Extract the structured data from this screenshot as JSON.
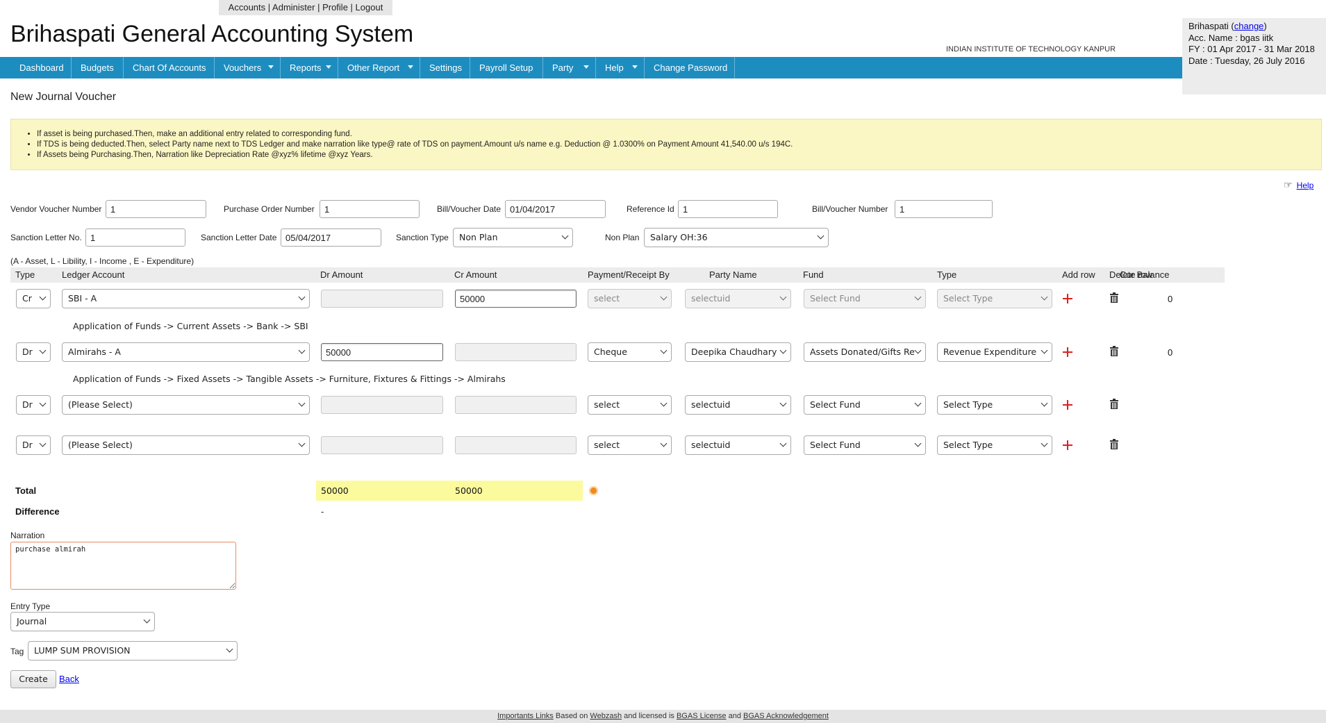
{
  "top_links": [
    "Accounts",
    "Administer",
    "Profile",
    "Logout"
  ],
  "app_title": "Brihaspati General Accounting System",
  "institute": "INDIAN INSTITUTE OF TECHNOLOGY KANPUR",
  "account_box": {
    "user": "Brihaspati",
    "change_link": "change",
    "account_name": "Acc. Name : bgas iitk",
    "fy": "FY : 01 Apr 2017 - 31 Mar 2018",
    "date": "Date : Tuesday, 26 July 2016"
  },
  "nav": [
    "Dashboard",
    "Budgets",
    "Chart Of Accounts",
    "Vouchers",
    "Reports",
    "Other Report",
    "Settings",
    "Payroll Setup",
    "Party",
    "Help",
    "Change Password"
  ],
  "page_title": "New Journal Voucher",
  "notices": [
    "If asset is being purchased.Then, make an additional entry related to corresponding fund.",
    "If TDS is being deducted.Then, select Party name next to TDS Ledger and make narration like type@ rate of TDS on payment.Amount u/s name e.g. Deduction @ 1.0300% on Payment Amount 41,540.00 u/s 194C.",
    "If Assets being Purchasing.Then, Narration like Depreciation Rate @xyz% lifetime @xyz Years."
  ],
  "help_label": "Help",
  "form": {
    "vendor_voucher_number": {
      "label": "Vendor Voucher Number",
      "value": "1"
    },
    "purchase_order_number": {
      "label": "Purchase Order Number",
      "value": "1"
    },
    "bill_voucher_date": {
      "label": "Bill/Voucher Date",
      "value": "01/04/2017"
    },
    "reference_id": {
      "label": "Reference Id",
      "value": "1"
    },
    "bill_voucher_number": {
      "label": "Bill/Voucher Number",
      "value": "1"
    },
    "sanction_letter_no": {
      "label": "Sanction Letter No.",
      "value": "1"
    },
    "sanction_letter_date": {
      "label": "Sanction Letter Date",
      "value": "05/04/2017"
    },
    "sanction_type": {
      "label": "Sanction Type",
      "value": "Non Plan"
    },
    "non_plan": {
      "label": "Non Plan",
      "value": "Salary OH:36"
    }
  },
  "legend": "(A - Asset, L - Libility, I - Income , E - Expenditure)",
  "columns": [
    "Type",
    "Ledger Account",
    "Dr Amount",
    "Cr Amount",
    "Payment/Receipt By",
    "Party Name",
    "Fund",
    "Type",
    "Add row",
    "Delete row",
    "Cur Balance"
  ],
  "rows": [
    {
      "type": "Cr",
      "ledger": "SBI - A",
      "dr": "",
      "cr": "50000",
      "payment": "select",
      "party": "selectuid",
      "fund": "Select Fund",
      "type2": "Select Type",
      "balance": "0",
      "path": "Application of Funds -> Current Assets -> Bank -> SBI"
    },
    {
      "type": "Dr",
      "ledger": "Almirahs - A",
      "dr": "50000",
      "cr": "",
      "payment": "Cheque",
      "party": "Deepika Chaudhary",
      "fund": "Assets Donated/Gifts Re",
      "type2": "Revenue Expenditure",
      "balance": "0",
      "path": "Application of Funds -> Fixed Assets -> Tangible Assets -> Furniture, Fixtures & Fittings -> Almirahs"
    },
    {
      "type": "Dr",
      "ledger": "(Please Select)",
      "dr": "",
      "cr": "",
      "payment": "select",
      "party": "selectuid",
      "fund": "Select Fund",
      "type2": "Select Type",
      "balance": "",
      "path": ""
    },
    {
      "type": "Dr",
      "ledger": "(Please Select)",
      "dr": "",
      "cr": "",
      "payment": "select",
      "party": "selectuid",
      "fund": "Select Fund",
      "type2": "Select Type",
      "balance": "",
      "path": ""
    }
  ],
  "totals": {
    "label": "Total",
    "dr": "50000",
    "cr": "50000",
    "difference_label": "Difference",
    "difference": "-"
  },
  "narration": {
    "label": "Narration",
    "value": "purchase almirah"
  },
  "entry_type": {
    "label": "Entry Type",
    "value": "Journal"
  },
  "tag": {
    "label": "Tag",
    "value": "LUMP SUM PROVISION"
  },
  "buttons": {
    "create": "Create",
    "back": "Back"
  },
  "footer": {
    "important_links": "Importants Links",
    "based_on": "Based on",
    "webzash": "Webzash",
    "licensed": "and licensed is",
    "bgas_license": "BGAS License",
    "and": "and",
    "bgas_ack": "BGAS Acknowledgement"
  },
  "colors": {
    "nav_bg": "#1d8dc0",
    "notice_bg": "#fbf7c4",
    "total_bg": "#fbfb9e",
    "plus": "#e0201b"
  }
}
